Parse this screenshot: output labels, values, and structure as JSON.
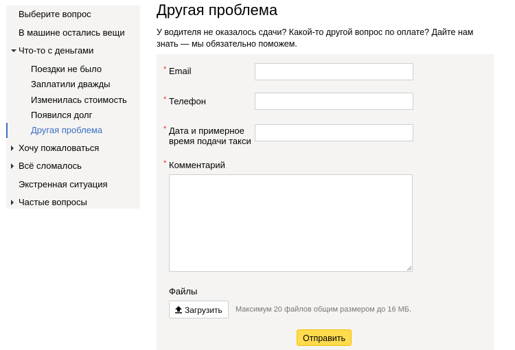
{
  "sidebar": {
    "items": [
      {
        "label": "Выберите вопрос"
      },
      {
        "label": "В машине остались вещи"
      },
      {
        "label": "Что-то с деньгами",
        "expanded": true,
        "children": [
          {
            "label": "Поездки не было"
          },
          {
            "label": "Заплатили дважды"
          },
          {
            "label": "Изменилась стоимость"
          },
          {
            "label": "Появился долг"
          },
          {
            "label": "Другая проблема",
            "active": true
          }
        ]
      },
      {
        "label": "Хочу пожаловаться",
        "expanded": false
      },
      {
        "label": "Всё сломалось",
        "expanded": false
      },
      {
        "label": "Экстренная ситуация"
      },
      {
        "label": "Частые вопросы",
        "expanded": false
      }
    ]
  },
  "main": {
    "title": "Другая проблема",
    "intro": "У водителя не оказалось сдачи? Какой-то другой вопрос по оплате? Дайте нам знать — мы обязательно поможем."
  },
  "form": {
    "required_mark": "*",
    "email": {
      "label": "Email",
      "value": ""
    },
    "phone": {
      "label": "Телефон",
      "value": ""
    },
    "datetime": {
      "label_line1": "Дата и примерное",
      "label_line2": "время подачи такси",
      "value": ""
    },
    "comment": {
      "label": "Комментарий",
      "value": ""
    },
    "files": {
      "label": "Файлы",
      "upload_label": "Загрузить",
      "hint": "Максимум 20 файлов общим размером до 16 МБ."
    },
    "submit_label": "Отправить"
  },
  "colors": {
    "accent": "#3b6fc4",
    "required": "#e3331f",
    "submit_bg": "#ffdb4d",
    "panel_bg": "#f5f4f2"
  }
}
